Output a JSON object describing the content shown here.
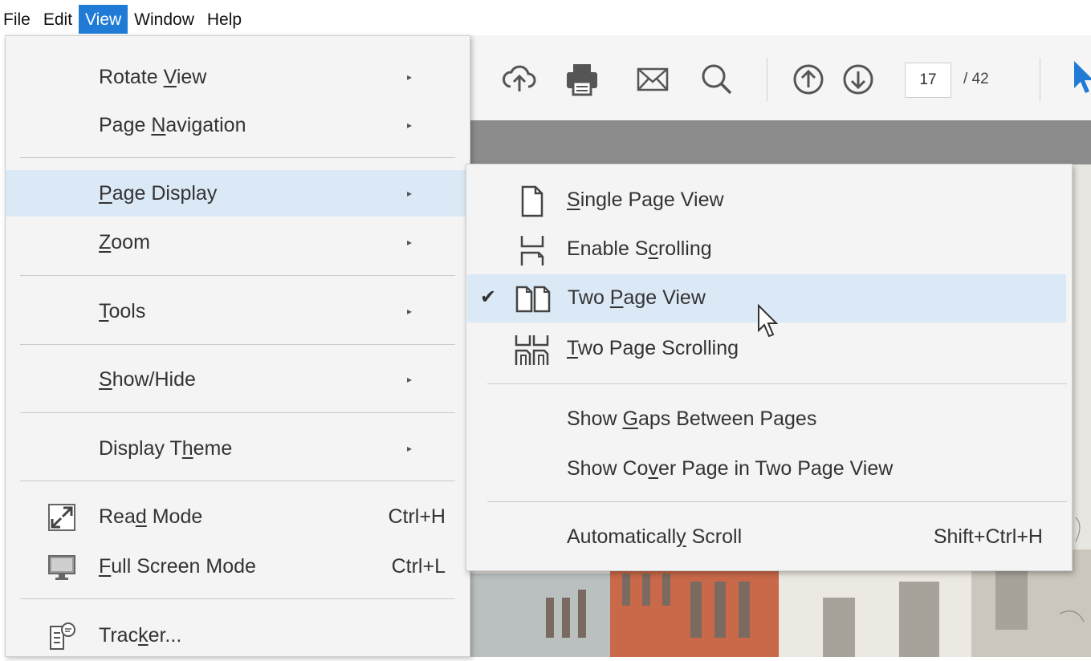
{
  "menubar": {
    "items": [
      {
        "label": "File"
      },
      {
        "label": "Edit"
      },
      {
        "label": "View",
        "active": true
      },
      {
        "label": "Window"
      },
      {
        "label": "Help"
      }
    ]
  },
  "toolbar": {
    "icons": [
      "upload-cloud-icon",
      "print-icon",
      "email-icon",
      "search-icon",
      "page-up-icon",
      "page-down-icon",
      "select-cursor-icon"
    ],
    "page_current": "17",
    "page_total": "/ 42"
  },
  "view_menu": {
    "items": [
      {
        "pre": "Rotate ",
        "u": "V",
        "post": "iew",
        "submenu": true
      },
      {
        "pre": "Page ",
        "u": "N",
        "post": "avigation",
        "submenu": true
      },
      {
        "pre": "",
        "u": "P",
        "post": "age Display",
        "submenu": true,
        "highlight": true
      },
      {
        "pre": "",
        "u": "Z",
        "post": "oom",
        "submenu": true
      },
      {
        "pre": "",
        "u": "T",
        "post": "ools",
        "submenu": true
      },
      {
        "pre": "",
        "u": "S",
        "post": "how/Hide",
        "submenu": true
      },
      {
        "pre": "Display T",
        "u": "h",
        "post": "eme",
        "submenu": true
      },
      {
        "pre": "Rea",
        "u": "d",
        "post": " Mode",
        "shortcut": "Ctrl+H",
        "icon": "read-mode-icon"
      },
      {
        "pre": "",
        "u": "F",
        "post": "ull Screen Mode",
        "shortcut": "Ctrl+L",
        "icon": "full-screen-icon"
      },
      {
        "pre": "Trac",
        "u": "k",
        "post": "er...",
        "icon": "tracker-icon"
      }
    ],
    "arrow_glyph": "▸"
  },
  "page_display_menu": {
    "items": [
      {
        "pre": "",
        "u": "S",
        "post": "ingle Page View",
        "icon": "single-page-icon"
      },
      {
        "pre": "Enable S",
        "u": "c",
        "post": "rolling",
        "icon": "enable-scrolling-icon"
      },
      {
        "pre": "Two ",
        "u": "P",
        "post": "age View",
        "icon": "two-page-icon",
        "checked": true,
        "highlight": true
      },
      {
        "pre": "",
        "u": "T",
        "post": "wo Page Scrolling",
        "icon": "two-page-scrolling-icon"
      },
      {
        "pre": "Show ",
        "u": "G",
        "post": "aps Between Pages"
      },
      {
        "pre": "Show Co",
        "u": "v",
        "post": "er Page in Two Page View"
      },
      {
        "pre": "Automaticall",
        "u": "y",
        "post": " Scroll",
        "shortcut": "Shift+Ctrl+H"
      }
    ],
    "check_glyph": "✔"
  },
  "colors": {
    "menu_bg": "#f4f4f4",
    "highlight": "#dbe8f5",
    "menubar_active": "#1f7bd6",
    "cursor_blue": "#1f7bd6"
  }
}
